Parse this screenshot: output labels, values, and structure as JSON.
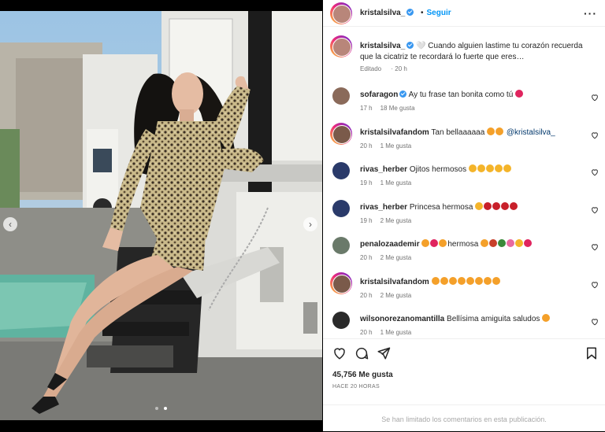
{
  "post": {
    "username": "kristalsilva_",
    "follow_label": "Seguir",
    "follow_separator": "•",
    "more_icon": "···",
    "caption_prefix": "🤍",
    "caption": "Cuando alguien lastime tu corazón recuerda que la cicatriz te recordará lo fuerte que eres…",
    "caption_edited": "Editado",
    "caption_time": "20 h",
    "likes": "45,756 Me gusta",
    "posted_ago": "HACE 20 HORAS",
    "comments_limited": "Se han limitado los comentarios en esta publicación."
  },
  "comments": [
    {
      "user": "sofaragon",
      "verified": true,
      "text": "Ay tu frase tan bonita como tú",
      "emojis": [
        "#e0245e"
      ],
      "time": "17 h",
      "likes": "18 Me gusta",
      "avatar_color": "#8a6a5a"
    },
    {
      "user": "kristalsilvafandom",
      "verified": false,
      "text": "Tan bellaaaaaa",
      "emojis": [
        "#f4a02a",
        "#f4a02a"
      ],
      "mention": "@kristalsilva_",
      "time": "20 h",
      "likes": "1 Me gusta",
      "avatar_color": "#7a5a4a",
      "ring": true
    },
    {
      "user": "rivas_herber",
      "verified": false,
      "text": "Ojitos hermosos",
      "emojis": [
        "#f4b42a",
        "#f4b42a",
        "#f4b42a",
        "#f4b42a",
        "#f4b42a"
      ],
      "time": "19 h",
      "likes": "1 Me gusta",
      "avatar_color": "#2a3a6a"
    },
    {
      "user": "rivas_herber",
      "verified": false,
      "text": "Princesa hermosa",
      "emojis": [
        "#f4b42a",
        "#c8202a",
        "#c8202a",
        "#c8202a",
        "#c8202a"
      ],
      "time": "19 h",
      "likes": "2 Me gusta",
      "avatar_color": "#2a3a6a"
    },
    {
      "user": "penalozaademir",
      "verified": false,
      "text": "hermosa",
      "emojis_before": [
        "#f4a02a",
        "#e0245e",
        "#f4a02a"
      ],
      "emojis": [
        "#f4a02a",
        "#c8402a",
        "#3a8a3a",
        "#e86aa0",
        "#f4b42a",
        "#e0245e"
      ],
      "time": "20 h",
      "likes": "2 Me gusta",
      "avatar_color": "#6a7a6a"
    },
    {
      "user": "kristalsilvafandom",
      "verified": false,
      "text": "",
      "emojis": [
        "#f4a02a",
        "#f4a02a",
        "#f4a02a",
        "#f4a02a",
        "#f4a02a",
        "#f4a02a",
        "#f4a02a",
        "#f4a02a"
      ],
      "time": "20 h",
      "likes": "2 Me gusta",
      "avatar_color": "#7a5a4a",
      "ring": true
    },
    {
      "user": "wilsonorezanomantilla",
      "verified": false,
      "text": "Bellísima amiguita saludos",
      "emojis": [
        "#f4a02a"
      ],
      "time": "20 h",
      "likes": "1 Me gusta",
      "avatar_color": "#2a2a2a"
    }
  ],
  "icons": {
    "heart": "heart-icon",
    "comment": "comment-icon",
    "share": "share-icon",
    "save": "bookmark-icon",
    "prev": "chevron-left-icon",
    "next": "chevron-right-icon",
    "prev_glyph": "‹",
    "next_glyph": "›"
  },
  "carousel": {
    "count": 2,
    "active": 1
  }
}
